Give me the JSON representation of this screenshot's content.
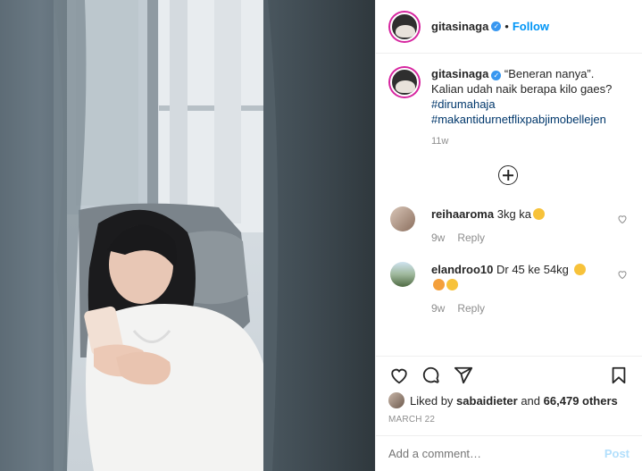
{
  "post": {
    "username": "gitasinaga",
    "verified_mark": "✓",
    "separator": "•",
    "follow_label": "Follow"
  },
  "caption": {
    "username": "gitasinaga",
    "text": "“Beneran nanya”. Kalian udah naik berapa kilo gaes?",
    "hashtags": [
      "#dirumahaja",
      "#makantidurnetflixpabjimobellejen"
    ],
    "time": "11w"
  },
  "load_more_icon": "plus-circle-icon",
  "comments": [
    {
      "username": "reihaaroma",
      "text": "3kg ka",
      "emoji": "grinning-sweat",
      "time": "9w",
      "reply_label": "Reply"
    },
    {
      "username": "elandroo10",
      "text": "Dr 45 ke 54kg",
      "emoji": "tired-face",
      "emoji2": "dizzy-face, grimacing-face",
      "time": "9w",
      "reply_label": "Reply"
    }
  ],
  "actions": {
    "icons": [
      "heart-icon",
      "comment-icon",
      "share-icon",
      "bookmark-icon"
    ]
  },
  "likes": {
    "prefix": "Liked by",
    "user": "sabaidieter",
    "middle": "and",
    "count": "66,479 others"
  },
  "date": "MARCH 22",
  "add_comment": {
    "placeholder": "Add a comment…",
    "post_label": "Post"
  },
  "colors": {
    "link_blue": "#0095f6",
    "hashtag": "#00376b",
    "muted": "#8e8e8e",
    "post_disabled": "#b2dffc"
  }
}
